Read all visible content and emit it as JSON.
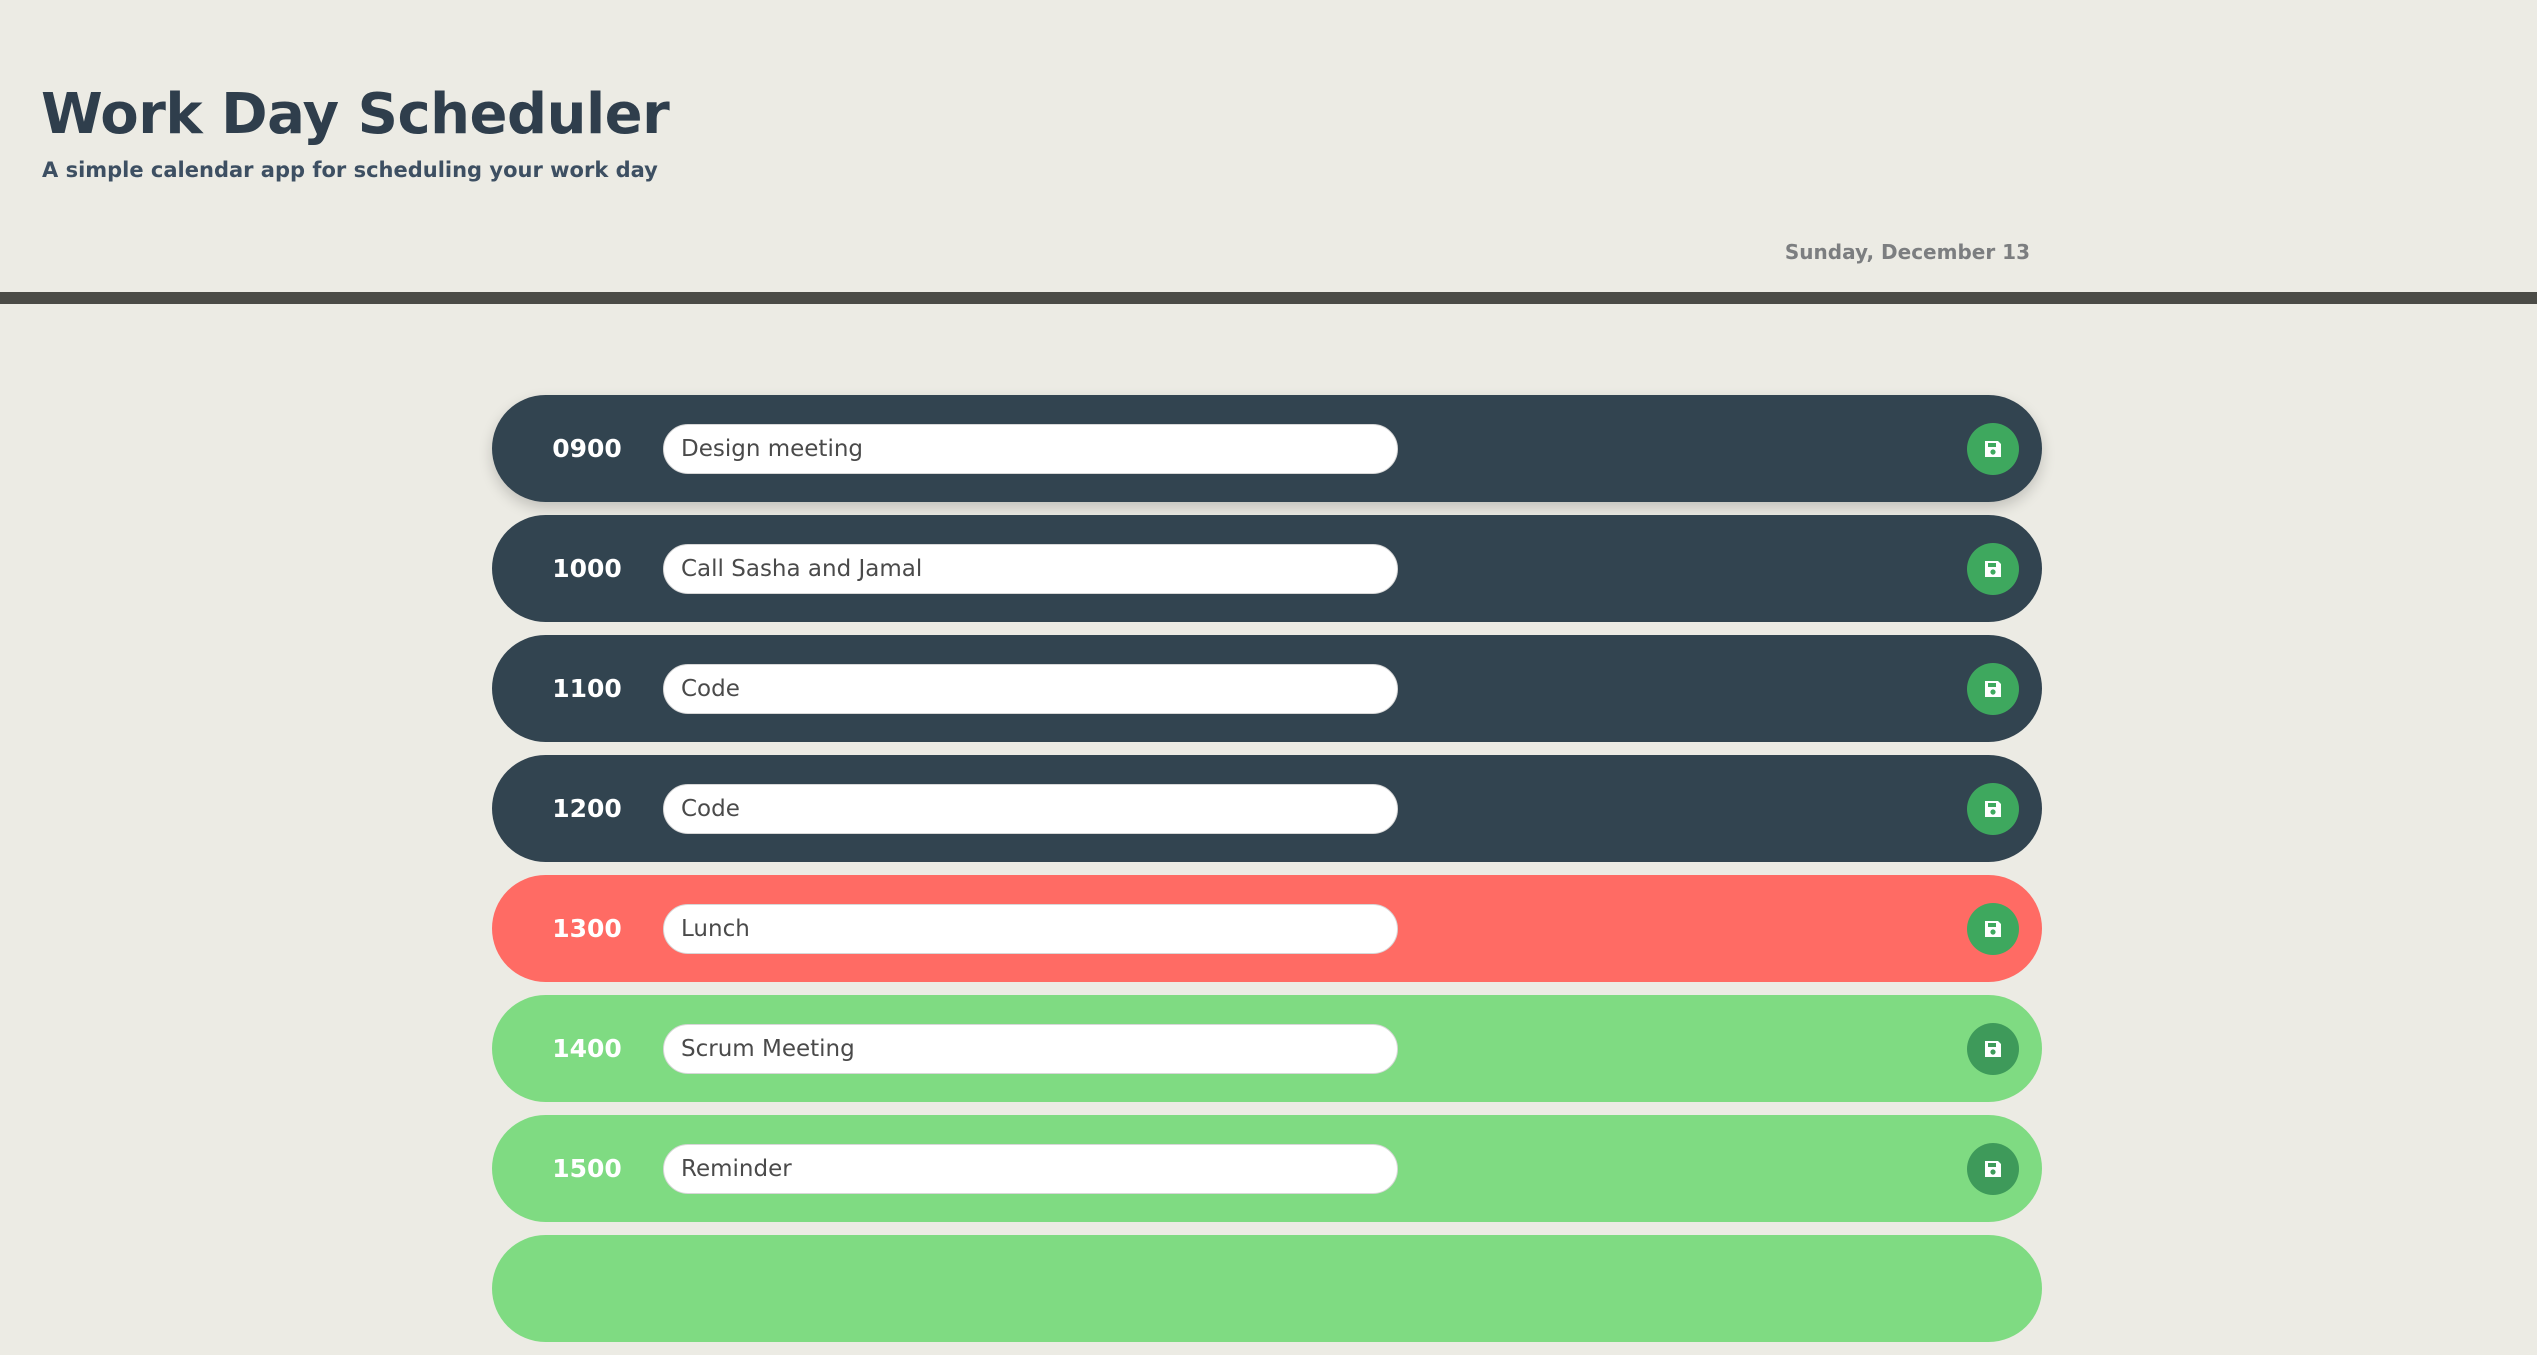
{
  "header": {
    "title": "Work Day Scheduler",
    "subtitle": "A simple calendar app for scheduling your work day",
    "current_day": "Sunday, December 13"
  },
  "colors": {
    "past": "#324450",
    "present": "#FF6B64",
    "future": "#7FDB82",
    "save_button": "#3EA85E",
    "save_icon": "floppy-disk-icon"
  },
  "timeblocks": [
    {
      "hour": "0900",
      "description": "Design meeting",
      "state": "past"
    },
    {
      "hour": "1000",
      "description": "Call Sasha and Jamal",
      "state": "past"
    },
    {
      "hour": "1100",
      "description": "Code",
      "state": "past"
    },
    {
      "hour": "1200",
      "description": "Code",
      "state": "past"
    },
    {
      "hour": "1300",
      "description": "Lunch",
      "state": "present"
    },
    {
      "hour": "1400",
      "description": "Scrum Meeting",
      "state": "future"
    },
    {
      "hour": "1500",
      "description": "Reminder",
      "state": "future"
    },
    {
      "hour": "",
      "description": "",
      "state": "future"
    }
  ]
}
